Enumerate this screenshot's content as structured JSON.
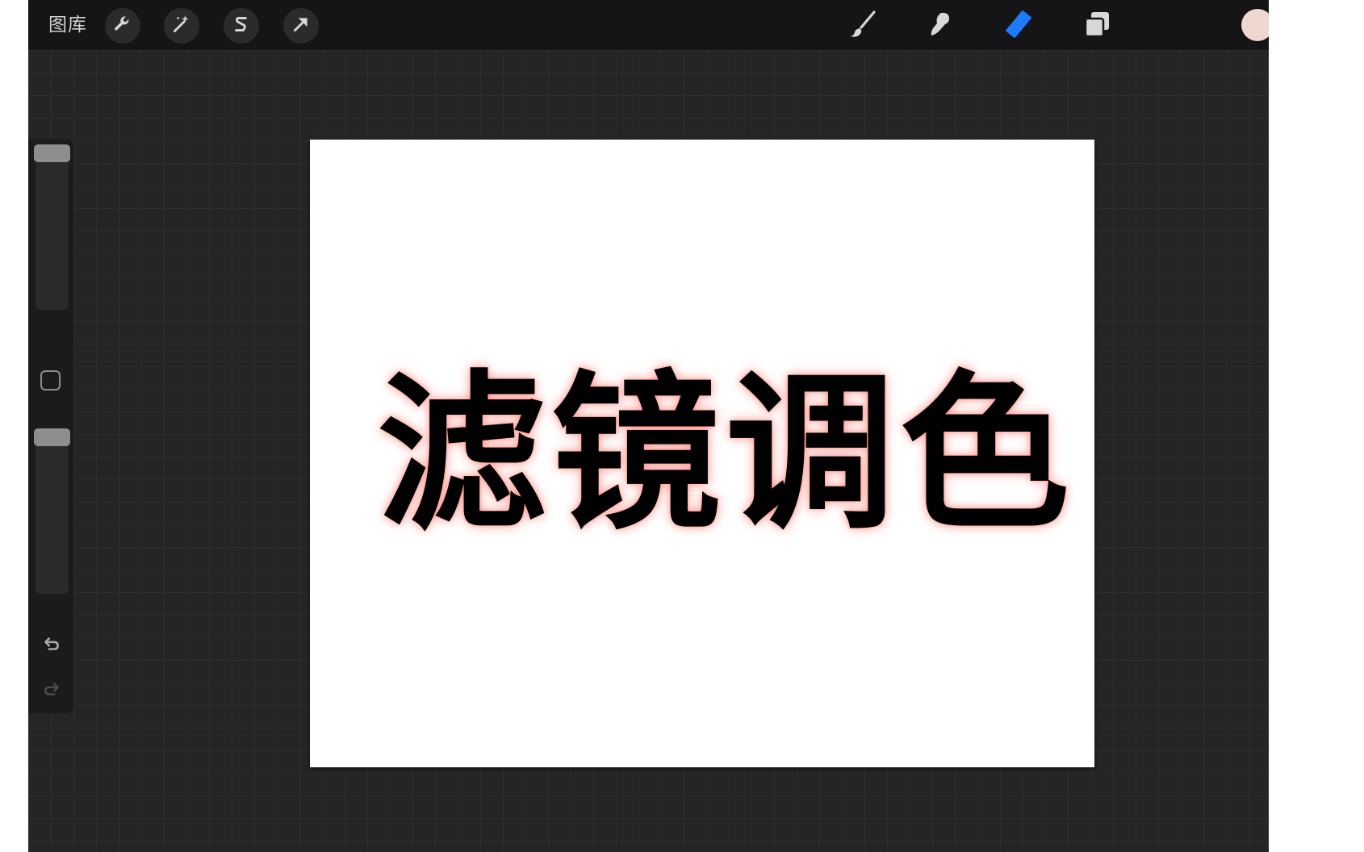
{
  "toolbar": {
    "gallery_label": "图库",
    "left_tools": [
      {
        "icon": "wrench-icon",
        "name": "actions"
      },
      {
        "icon": "magic-wand-icon",
        "name": "adjustments"
      },
      {
        "icon": "selection-s-icon",
        "name": "selection"
      },
      {
        "icon": "arrow-cursor-icon",
        "name": "transform"
      }
    ],
    "right_tools": [
      {
        "icon": "brush-icon",
        "name": "paint",
        "active": false
      },
      {
        "icon": "smudge-icon",
        "name": "smudge",
        "active": false
      },
      {
        "icon": "eraser-icon",
        "name": "erase",
        "active": true
      },
      {
        "icon": "layers-icon",
        "name": "layers",
        "active": false
      }
    ],
    "current_color": "#efd7d0",
    "active_color": "#1e7bff"
  },
  "sidebar": {
    "brush_size_label": "brush-size",
    "opacity_label": "opacity",
    "undo_icon": "undo-icon",
    "redo_icon": "redo-icon"
  },
  "canvas": {
    "text": "滤镜调色",
    "text_color": "#000000",
    "glow_color": "#ff7a70"
  }
}
